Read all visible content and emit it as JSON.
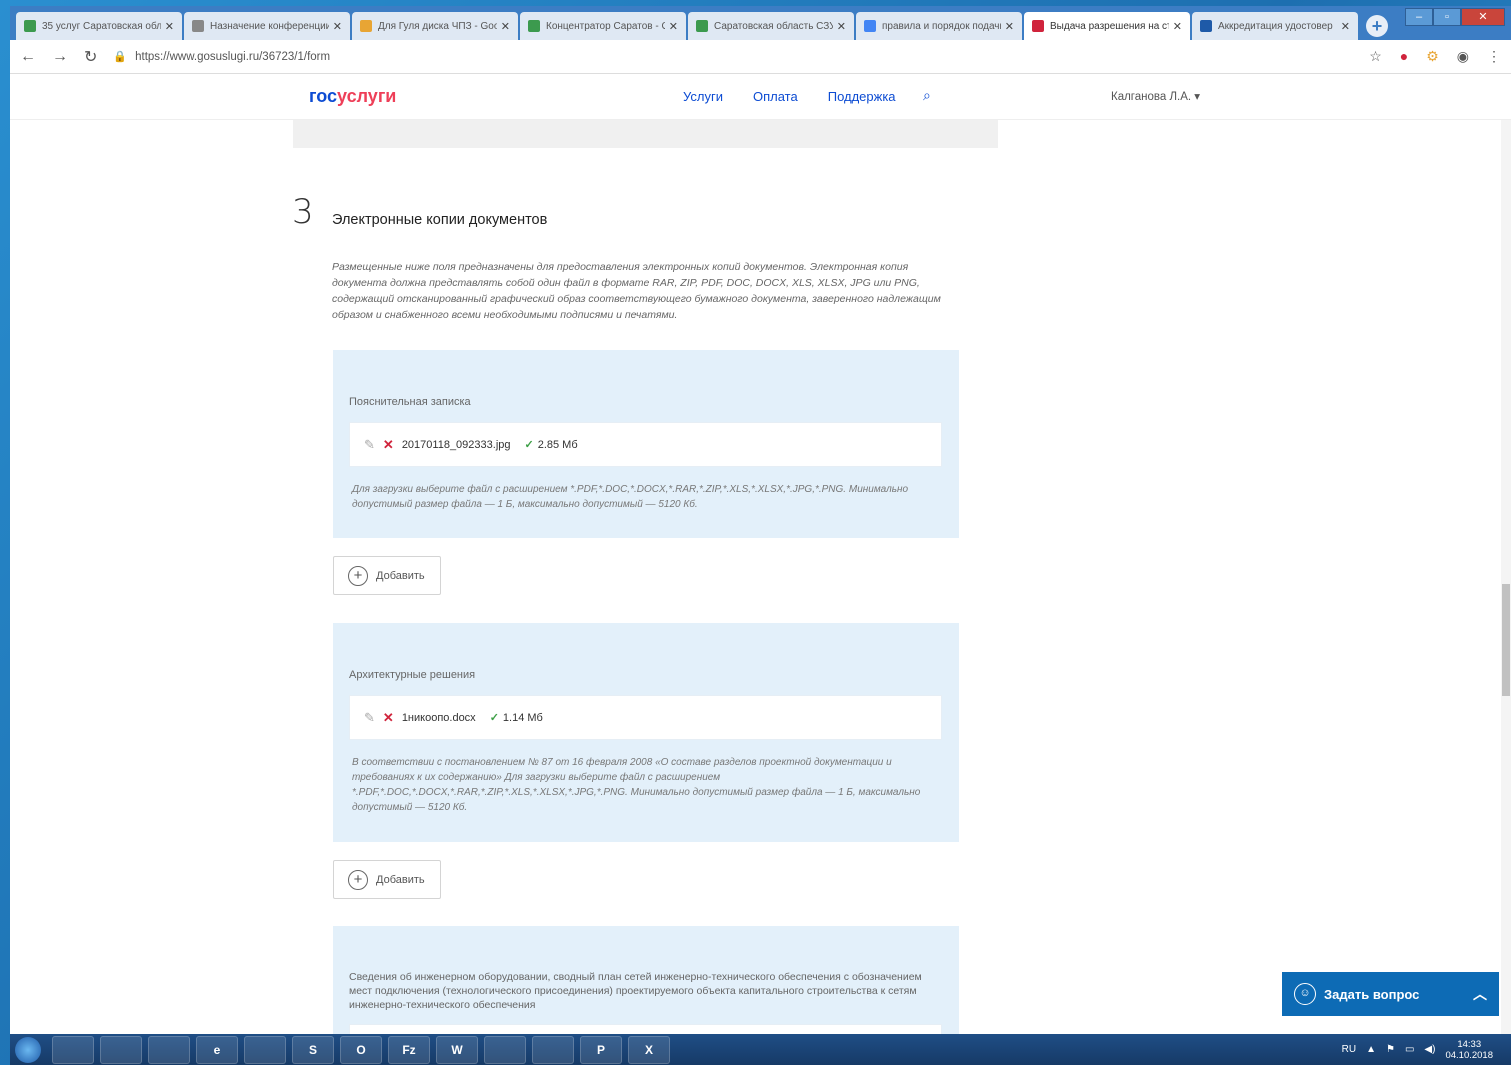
{
  "browser": {
    "tabs": [
      {
        "title": "35 услуг Саратовская обл",
        "color": "#3c9a4e"
      },
      {
        "title": "Назначение конференции",
        "color": "#888888"
      },
      {
        "title": "Для Гуля диска ЧПЗ - Goog",
        "color": "#e8a534"
      },
      {
        "title": "Концентратор Саратов - Gl",
        "color": "#3c9a4e"
      },
      {
        "title": "Саратовская область СЗУ",
        "color": "#3c9a4e"
      },
      {
        "title": "правила и порядок подачи",
        "color": "#4285f4"
      },
      {
        "title": "Выдача разрешения на стр",
        "color": "#d0243c"
      },
      {
        "title": "Аккредитация удостовер",
        "color": "#1e5aa8"
      }
    ],
    "active_tab": 6,
    "url": "https://www.gosuslugi.ru/36723/1/form"
  },
  "header": {
    "logo_part1": "гос",
    "logo_part2": "услуги",
    "nav": [
      "Услуги",
      "Оплата",
      "Поддержка"
    ],
    "user": "Калганова Л.А. ▾"
  },
  "section": {
    "number": "3",
    "title": "Электронные копии документов",
    "intro": "Размещенные ниже поля предназначены для предоставления электронных копий документов. Электронная копия документа должна представлять собой один файл в формате RAR, ZIP, PDF, DOC, DOCX, XLS, XLSX, JPG или PNG, содержащий отсканированный графический образ соответствующего бумажного документа, заверенного надлежащим образом и снабженного всеми необходимыми подписями и печатями."
  },
  "blocks": [
    {
      "label": "Пояснительная записка",
      "file_name": "20170118_092333.jpg",
      "file_size": "2.85 Мб",
      "hint": "Для загрузки выберите файл с расширением *.PDF,*.DOC,*.DOCX,*.RAR,*.ZIP,*.XLS,*.XLSX,*.JPG,*.PNG. Минимально допустимый размер файла — 1 Б, максимально допустимый — 5120 Кб."
    },
    {
      "label": "Архитектурные решения",
      "file_name": "1никоопо.docx",
      "file_size": "1.14 Мб",
      "hint": "В соответствии с постановлением № 87 от 16 февраля 2008 «О составе разделов проектной документации и требованиях к их содержанию» Для загрузки выберите файл с расширением *.PDF,*.DOC,*.DOCX,*.RAR,*.ZIP,*.XLS,*.XLSX,*.JPG,*.PNG. Минимально допустимый размер файла — 1 Б, максимально допустимый — 5120 Кб."
    },
    {
      "label": "Сведения об инженерном оборудовании, сводный план сетей инженерно-технического обеспечения с обозначением мест подключения (технологического присоединения) проектируемого объекта капитального строительства к сетям инженерно-технического обеспечения"
    }
  ],
  "add_button_label": "Добавить",
  "ask_button_label": "Задать вопрос",
  "taskbar": {
    "apps": [
      "",
      "",
      "",
      "e",
      "",
      "S",
      "O",
      "Fz",
      "W",
      "",
      "",
      "P",
      "X"
    ],
    "lang": "RU",
    "time": "14:33",
    "date": "04.10.2018"
  }
}
